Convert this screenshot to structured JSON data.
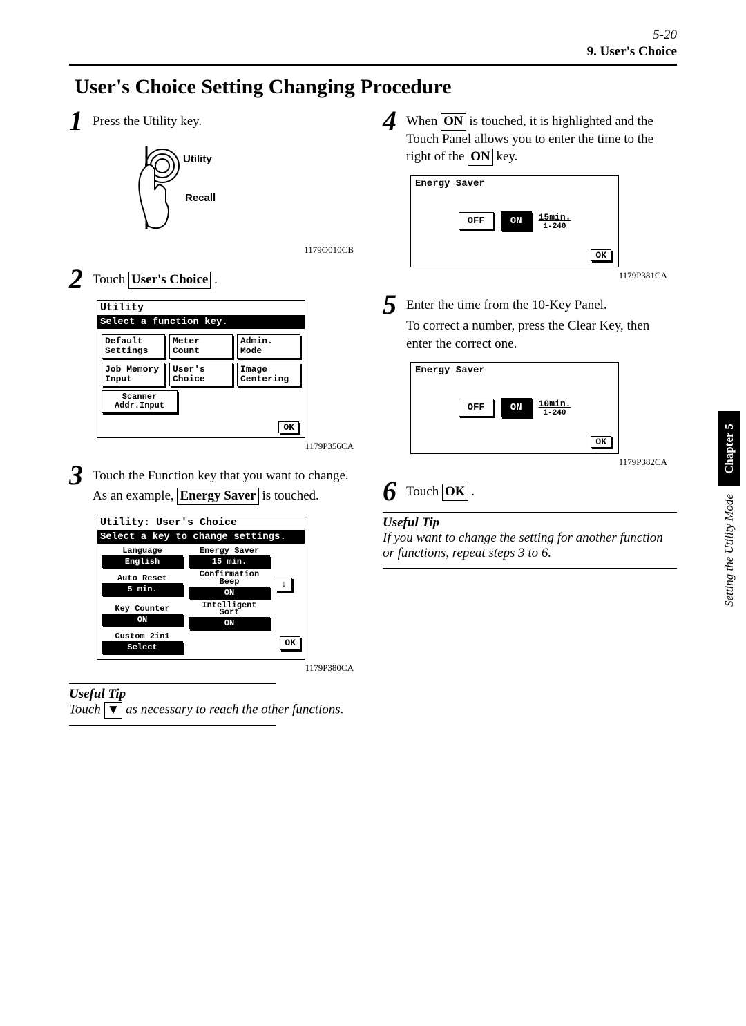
{
  "page_number": "5-20",
  "section_header": "9. User's Choice",
  "title": "User's Choice Setting Changing Procedure",
  "step1": {
    "num": "1",
    "text": "Press the Utility key.",
    "utility_label": "Utility",
    "recall_label": "Recall",
    "code": "1179O010CB"
  },
  "step2": {
    "num": "2",
    "text_a": "Touch ",
    "box": "User's Choice",
    "text_b": " .",
    "screen": {
      "title": "Utility",
      "banner": "Select a function key.",
      "buttons": [
        "Default\nSettings",
        "Meter\nCount",
        "Admin.\nMode",
        "Job Memory\nInput",
        "User's\nChoice",
        "Image\nCentering",
        "Scanner\nAddr.Input"
      ],
      "ok": "OK",
      "code": "1179P356CA"
    }
  },
  "step3": {
    "num": "3",
    "text_a": "Touch the Function key that you want to change.",
    "text_b": "As an example, ",
    "box": "Energy Saver",
    "text_c": " is touched.",
    "screen": {
      "title": "Utility: User's Choice",
      "banner": "Select a key to change settings.",
      "rows": [
        [
          {
            "lbl": "Language",
            "val": "English"
          },
          {
            "lbl": "Energy Saver",
            "val": "15 min."
          }
        ],
        [
          {
            "lbl": "Auto Reset",
            "val": "5 min."
          },
          {
            "lbl": "Confirmation\nBeep",
            "val": "ON"
          }
        ],
        [
          {
            "lbl": "Key Counter",
            "val": "ON"
          },
          {
            "lbl": "Intelligent\nSort",
            "val": "ON"
          }
        ],
        [
          {
            "lbl": "Custom 2in1",
            "val": "Select"
          }
        ]
      ],
      "arrow": "↓",
      "ok": "OK",
      "code": "1179P380CA"
    }
  },
  "tip1": {
    "title": "Useful Tip",
    "text_a": "Touch ",
    "tri": "▼",
    "text_b": " as necessary to reach the other functions."
  },
  "step4": {
    "num": "4",
    "text_a": "When ",
    "box1": "ON",
    "text_b": " is touched, it is highlighted and the Touch Panel allows you to enter the time to the right of the ",
    "box2": "ON",
    "text_c": " key.",
    "screen": {
      "title": "Energy Saver",
      "off": "OFF",
      "on": "ON",
      "time": "15min.",
      "range": "1-240",
      "ok": "OK",
      "code": "1179P381CA"
    }
  },
  "step5": {
    "num": "5",
    "text_a": "Enter the time from the 10-Key Panel.",
    "text_b": "To correct a number, press the Clear Key, then enter the correct one.",
    "screen": {
      "title": "Energy Saver",
      "off": "OFF",
      "on": "ON",
      "time": "10min.",
      "range": "1-240",
      "ok": "OK",
      "code": "1179P382CA"
    }
  },
  "step6": {
    "num": "6",
    "text_a": "Touch ",
    "box": "OK",
    "text_b": " ."
  },
  "tip2": {
    "title": "Useful Tip",
    "text": "If you want to change the setting for another function or functions, repeat steps 3 to 6."
  },
  "sidetab": {
    "chapter": "Chapter 5",
    "label": "Setting the Utility Mode"
  }
}
